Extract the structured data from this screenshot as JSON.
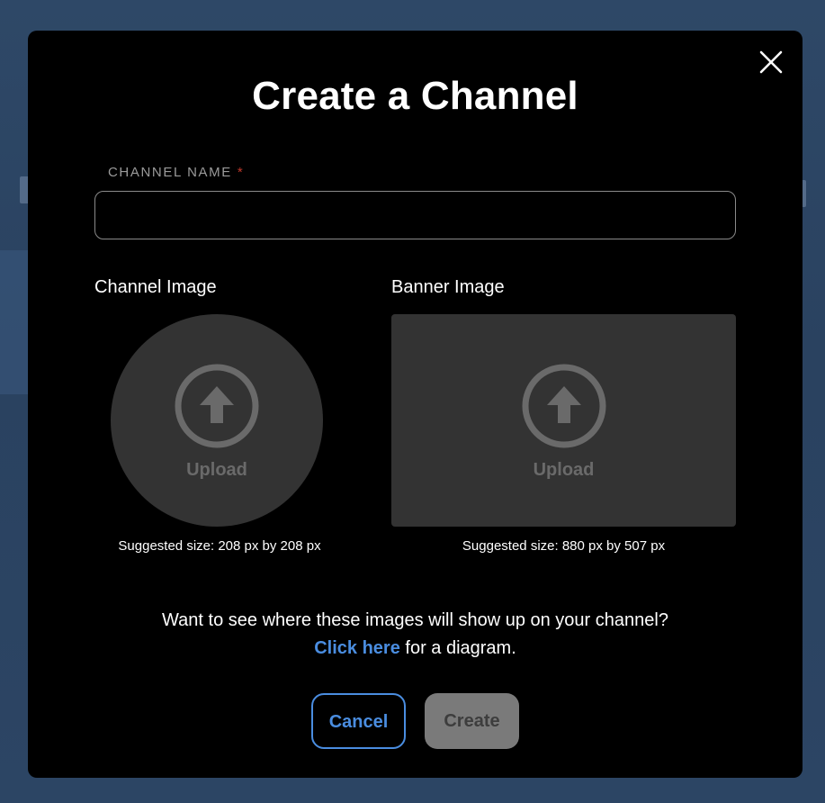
{
  "modal": {
    "title": "Create a Channel",
    "close_icon": "close-icon"
  },
  "channel_name": {
    "label": "CHANNEL NAME",
    "required_marker": "*",
    "value": "",
    "placeholder": ""
  },
  "channel_image": {
    "label": "Channel Image",
    "upload_label": "Upload",
    "upload_icon": "upload-arrow-icon",
    "hint": "Suggested size: 208 px by 208 px"
  },
  "banner_image": {
    "label": "Banner Image",
    "upload_label": "Upload",
    "upload_icon": "upload-arrow-icon",
    "hint": "Suggested size: 880 px by 507 px"
  },
  "info": {
    "question": "Want to see where these images will show up on your channel?",
    "link_text": "Click here",
    "link_suffix": " for a diagram."
  },
  "actions": {
    "cancel_label": "Cancel",
    "create_label": "Create"
  },
  "colors": {
    "accent": "#4a8de0",
    "modal_bg": "#000000",
    "upload_bg": "#333333",
    "required": "#c0392b",
    "disabled_button": "#7a7a7a"
  }
}
